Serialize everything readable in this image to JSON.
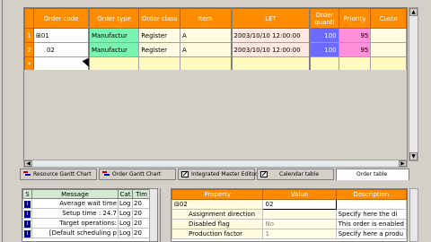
{
  "grid": {
    "headers": [
      "Order code",
      "Order type",
      "Order class",
      "Item",
      "LET",
      "Order quanti",
      "Priority",
      "Custo"
    ],
    "rows": [
      {
        "num": "1",
        "code": "⊞01",
        "type": "Manufactur",
        "class": "Register",
        "item": "A",
        "let": "2003/10/10 12:00:00",
        "qty": "100",
        "priority": "95",
        "customer": ""
      },
      {
        "num": "2",
        "code": "02",
        "type": "Manufactur",
        "class": "Register",
        "item": "A",
        "let": "2003/10/10 12:00:00",
        "qty": "100",
        "priority": "95",
        "customer": ""
      }
    ],
    "new_row_marker": "*"
  },
  "tabs": [
    "Resource Gantt Chart",
    "Order Gantt Chart",
    "Integrated Master Editor",
    "Calendar table",
    "Order table"
  ],
  "messages": {
    "headers": [
      "S",
      "Message",
      "Cat",
      "Tim"
    ],
    "rows": [
      {
        "msg": "Average wait time",
        "cat": "Log",
        "tim": "20"
      },
      {
        "msg": "Setup time : 24.7",
        "cat": "Log",
        "tim": "20"
      },
      {
        "msg": "Target operations:",
        "cat": "Log",
        "tim": "20"
      },
      {
        "msg": "[Default scheduling p",
        "cat": "Log",
        "tim": "20"
      }
    ]
  },
  "properties": {
    "headers": [
      "Property",
      "Value",
      "Description"
    ],
    "group": {
      "name": "⊟02",
      "value": "02",
      "desc": ""
    },
    "rows": [
      {
        "name": "Assignment direction",
        "value": "",
        "desc": "Specify here the di"
      },
      {
        "name": "Disabled flag",
        "value": "No",
        "desc": "This order is enabled"
      },
      {
        "name": "Production factor",
        "value": "1",
        "desc": "Specify here a produ"
      }
    ]
  },
  "colors": {
    "header_orange": "#ff8c00",
    "type_green": "#7cf2b0",
    "qty_blue": "#6b6bff",
    "prio_pink": "#ff8fd8"
  }
}
